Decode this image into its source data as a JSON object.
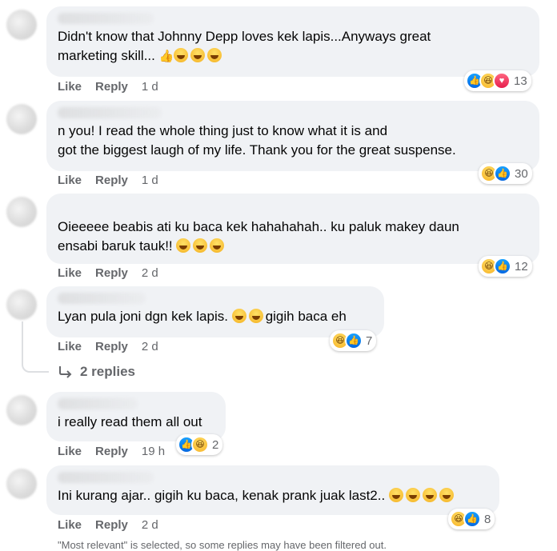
{
  "colors": {
    "bubble": "#f0f2f5",
    "meta_text": "#65676b",
    "text": "#050505",
    "like_blue": "#0668e1",
    "love_red": "#e61e4d",
    "haha_yellow": "#f7b125"
  },
  "labels": {
    "like": "Like",
    "reply": "Reply",
    "replies": "2 replies",
    "reply_arrow_icon": "reply-arrow-icon"
  },
  "comments": [
    {
      "text": "Didn't know that Johnny Depp loves kek lapis...Anyways great\nmarketing skill...",
      "inline_emoji": [
        "thumbs-up-emoji",
        "rofl-emoji",
        "rofl-emoji",
        "rofl-emoji"
      ],
      "time": "1 d",
      "reactions": [
        "like",
        "haha",
        "love"
      ],
      "count": "13"
    },
    {
      "text": "n you! I read the whole thing just to know what it is and\ngot the biggest laugh of my life. Thank you for the great suspense.",
      "inline_emoji": [],
      "time": "1 d",
      "reactions": [
        "haha",
        "like"
      ],
      "count": "30"
    },
    {
      "text": "Oieeeee beabis ati ku baca kek hahahahah.. ku paluk makey daun\nensabi baruk tauk!!",
      "inline_emoji": [
        "rofl-emoji",
        "rofl-emoji",
        "rofl-emoji"
      ],
      "time": "2 d",
      "reactions": [
        "haha",
        "like"
      ],
      "count": "12"
    },
    {
      "text": "Lyan pula joni dgn kek lapis.",
      "text_after": "gigih baca eh",
      "inline_emoji": [
        "laugh-emoji",
        "laugh-emoji"
      ],
      "time": "2 d",
      "reactions": [
        "haha",
        "like"
      ],
      "count": "7"
    },
    {
      "text": "i really read them all out",
      "inline_emoji": [],
      "time": "19 h",
      "reactions": [
        "like",
        "haha"
      ],
      "count": "2"
    },
    {
      "text": "Ini kurang ajar.. gigih ku baca, kenak prank juak last2..",
      "inline_emoji": [
        "rofl-emoji",
        "rofl-emoji",
        "rofl-emoji",
        "rofl-emoji"
      ],
      "time": "2 d",
      "reactions": [
        "haha",
        "like"
      ],
      "count": "8"
    }
  ],
  "footer": "\"Most relevant\" is selected, so some replies may have been filtered out."
}
